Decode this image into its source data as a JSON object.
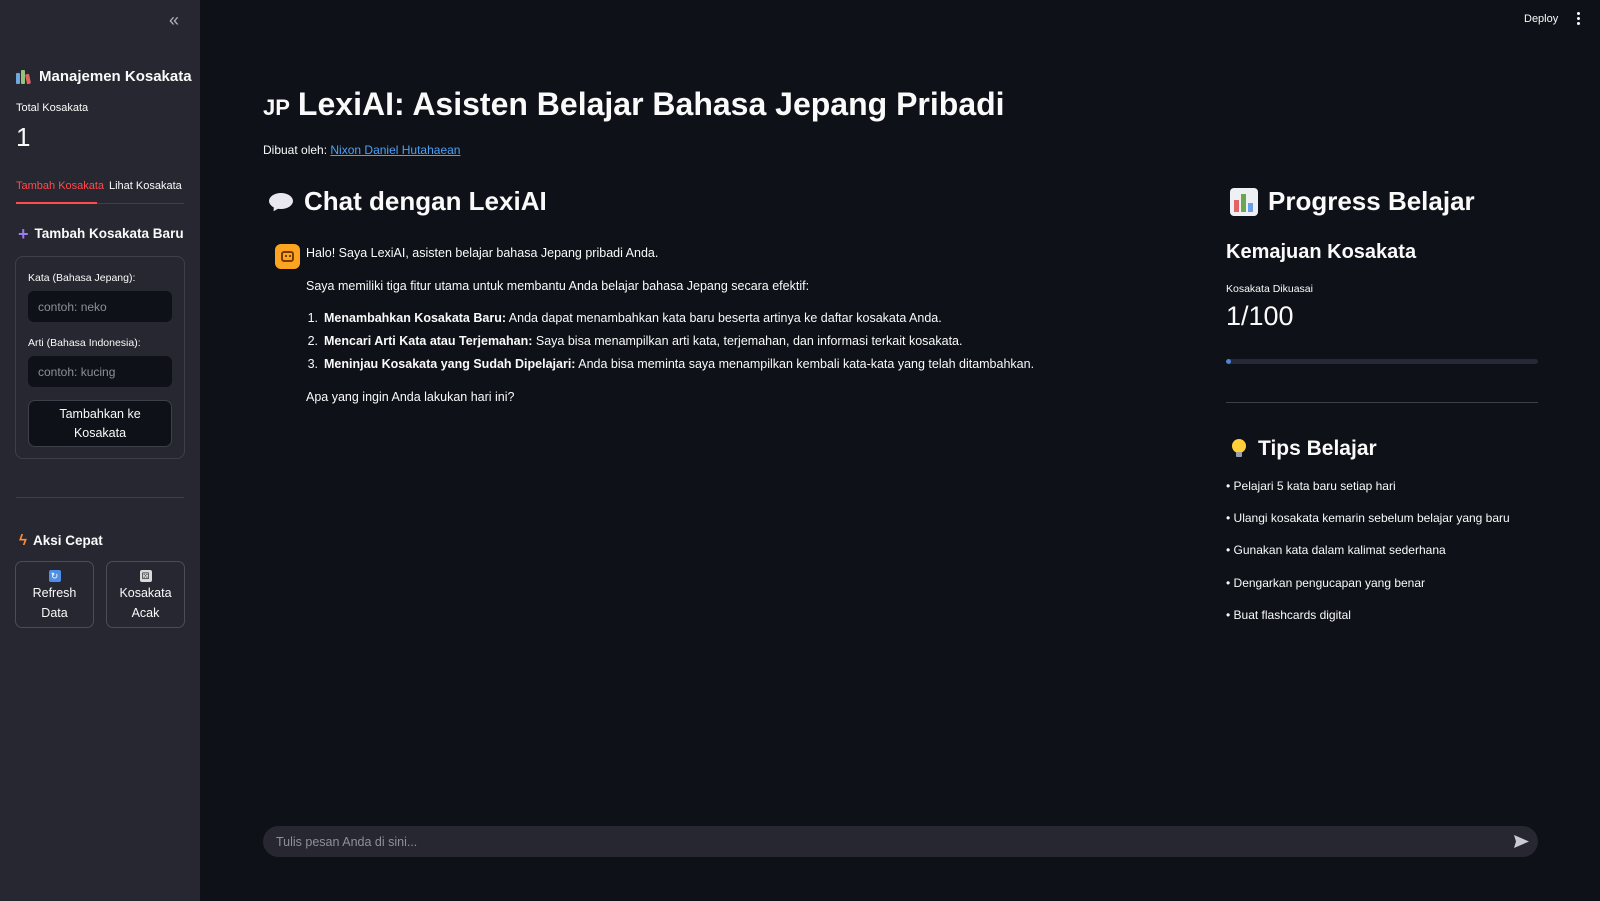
{
  "header": {
    "deploy_label": "Deploy",
    "menu_icon": "vertical-dots-icon"
  },
  "sidebar": {
    "collapse_icon": "«",
    "title": "Manajemen Kosakata",
    "metric": {
      "label": "Total Kosakata",
      "value": "1"
    },
    "tabs": [
      {
        "label": "Tambah Kosakata",
        "active": true
      },
      {
        "label": "Lihat Kosakata",
        "active": false
      }
    ],
    "add_section": {
      "title": "Tambah Kosakata Baru",
      "word_label": "Kata (Bahasa Jepang):",
      "word_placeholder": "contoh: neko",
      "meaning_label": "Arti (Bahasa Indonesia):",
      "meaning_placeholder": "contoh: kucing",
      "submit_line1": "Tambahkan ke",
      "submit_line2": "Kosakata"
    },
    "quick": {
      "title": "Aksi Cepat",
      "refresh_line1": "Refresh",
      "refresh_line2": "Data",
      "random_line1": "Kosakata",
      "random_line2": "Acak"
    }
  },
  "main": {
    "title_badge": "JP",
    "title": "LexiAI: Asisten Belajar Bahasa Jepang Pribadi",
    "credit_prefix": "Dibuat oleh:",
    "credit_link": "Nixon Daniel Hutahaean",
    "chat_heading": "Chat dengan LexiAI",
    "message": {
      "greeting": "Halo! Saya LexiAI, asisten belajar bahasa Jepang pribadi Anda.",
      "intro": "Saya memiliki tiga fitur utama untuk membantu Anda belajar bahasa Jepang secara efektif:",
      "features": [
        {
          "num": "1.",
          "bold": "Menambahkan Kosakata Baru:",
          "text": " Anda dapat menambahkan kata baru beserta artinya ke daftar kosakata Anda."
        },
        {
          "num": "2.",
          "bold": "Mencari Arti Kata atau Terjemahan:",
          "text": " Saya bisa menampilkan arti kata, terjemahan, dan informasi terkait kosakata."
        },
        {
          "num": "3.",
          "bold": "Meninjau Kosakata yang Sudah Dipelajari:",
          "text": " Anda bisa meminta saya menampilkan kembali kata-kata yang telah ditambahkan."
        }
      ],
      "closing": "Apa yang ingin Anda lakukan hari ini?"
    },
    "chat_input_placeholder": "Tulis pesan Anda di sini..."
  },
  "progress": {
    "heading": "Progress Belajar",
    "subheading": "Kemajuan Kosakata",
    "metric_label": "Kosakata Dikuasai",
    "metric_value": "1/100",
    "fraction": 0.01,
    "tips_heading": "Tips Belajar",
    "tips": [
      "• Pelajari 5 kata baru setiap hari",
      "• Ulangi kosakata kemarin sebelum belajar yang baru",
      "• Gunakan kata dalam kalimat sederhana",
      "• Dengarkan pengucapan yang benar",
      "• Buat flashcards digital"
    ]
  },
  "colors": {
    "accent": "#ff4b4b",
    "link": "#4ea1f5",
    "progress": "#4d84d8",
    "bot_avatar": "#ffa421"
  }
}
